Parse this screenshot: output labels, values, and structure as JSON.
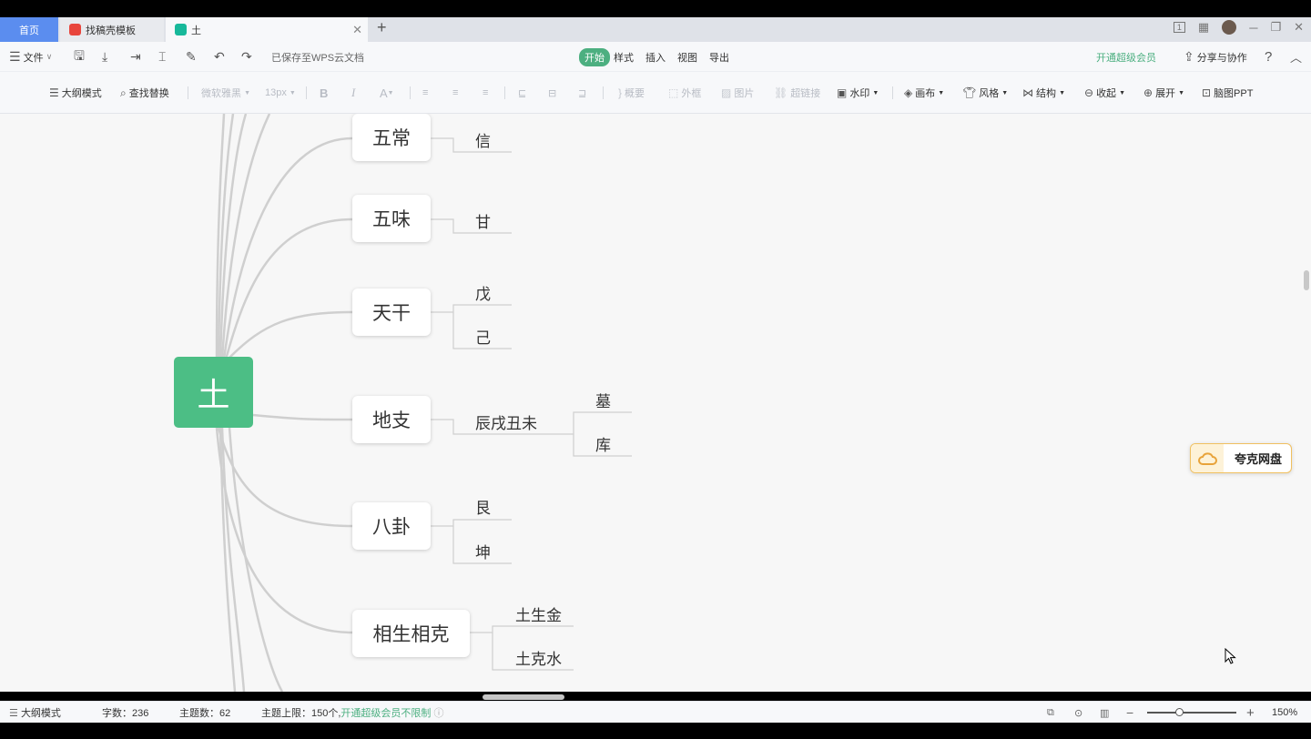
{
  "tabs": {
    "home": "首页",
    "template": "找稿壳模板",
    "doc": "土"
  },
  "menu": {
    "file": "文件",
    "saved_status": "已保存至WPS云文档",
    "tabs": [
      "开始",
      "样式",
      "插入",
      "视图",
      "导出"
    ],
    "vip": "开通超级会员",
    "share": "分享与协作"
  },
  "toolbar": {
    "outline": "大纲模式",
    "find_replace": "查找替换",
    "font_family": "微软雅黑",
    "font_size": "13px",
    "summary": "概要",
    "frame": "外框",
    "image": "图片",
    "hyperlink": "超链接",
    "watermark": "水印",
    "canvas": "画布",
    "style": "风格",
    "structure": "结构",
    "collapse": "收起",
    "expand": "展开",
    "ppt": "脑图PPT"
  },
  "mindmap": {
    "root": "土",
    "branches": [
      {
        "label": "五常",
        "children": [
          "信"
        ]
      },
      {
        "label": "五味",
        "children": [
          "甘"
        ]
      },
      {
        "label": "天干",
        "children": [
          "戊",
          "己"
        ]
      },
      {
        "label": "地支",
        "children": [
          "辰戌丑未"
        ],
        "grandchildren": [
          "墓",
          "库"
        ]
      },
      {
        "label": "八卦",
        "children": [
          "艮",
          "坤"
        ]
      },
      {
        "label": "相生相克",
        "children": [
          "土生金",
          "土克水"
        ]
      }
    ]
  },
  "quark": "夸克网盘",
  "status": {
    "outline": "大纲模式",
    "word_count": "字数：236",
    "topic_count": "主题数：62",
    "topic_limit": "主题上限：150个,",
    "vip_unlimited": "开通超级会员不限制",
    "zoom": "150%"
  },
  "colors": {
    "root": "#4cbe85",
    "accent": "#4caf80",
    "home_tab": "#5b8def"
  }
}
